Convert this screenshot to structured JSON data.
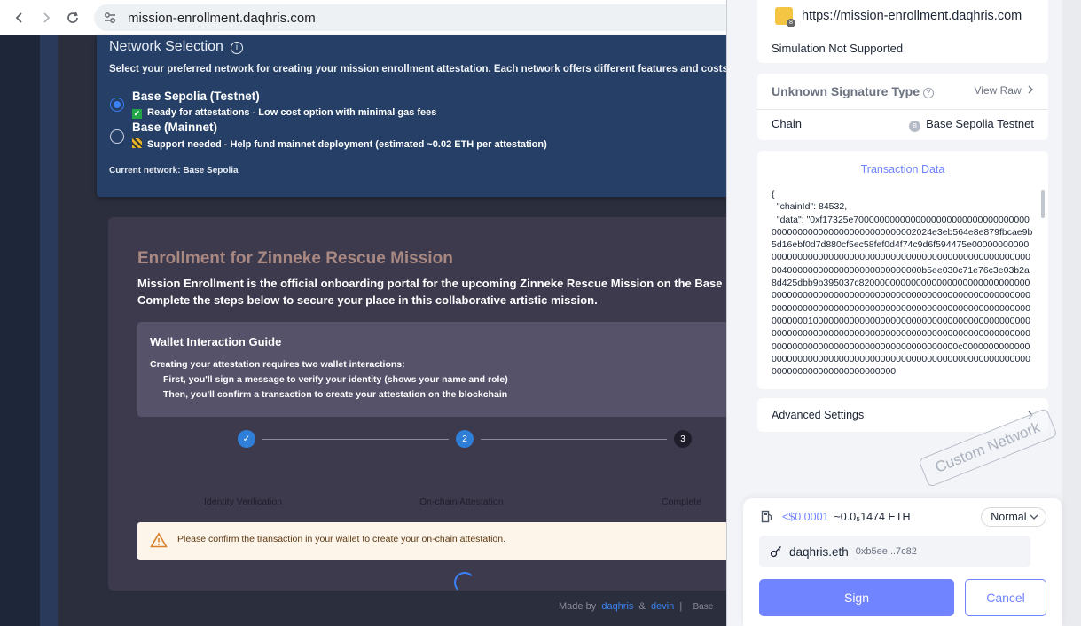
{
  "browser": {
    "url": "mission-enrollment.daqhris.com"
  },
  "network_selection": {
    "title": "Network Selection",
    "info_icon": "info-icon",
    "description": "Select your preferred network for creating your mission enrollment attestation. Each network offers different features and costs.",
    "options": [
      {
        "name": "Base Sepolia (Testnet)",
        "sub": "Ready for attestations - Low cost option with minimal gas fees",
        "badge_color": "#22a447",
        "selected": true
      },
      {
        "name": "Base (Mainnet)",
        "sub": "Support needed - Help fund mainnet deployment (estimated ~0.02 ETH per attestation)",
        "badge_color": "#e5b42a",
        "selected": false
      }
    ],
    "current": "Current network: Base Sepolia"
  },
  "enrollment": {
    "title": "Enrollment for Zinneke Rescue Mission",
    "line1": "Mission Enrollment is the official onboarding portal for the upcoming Zinneke Rescue Mission on the Base blockchain",
    "line2": "Complete the steps below to secure your place in this collaborative artistic mission.",
    "guide": {
      "title": "Wallet Interaction Guide",
      "intro": "Creating your attestation requires two wallet interactions:",
      "step1": "First, you'll sign a message to verify your identity (shows your name and role)",
      "step2": "Then, you'll confirm a transaction to create your attestation on the blockchain"
    },
    "steps": [
      {
        "label": "Identity Verification",
        "marker": "✓"
      },
      {
        "label": "On-chain Attestation",
        "marker": "2"
      },
      {
        "label": "Complete",
        "marker": "3"
      }
    ],
    "alert": "Please confirm the transaction in your wallet to create your on-chain attestation."
  },
  "footer": {
    "made_by": "Made by",
    "author1": "daqhris",
    "amp": "&",
    "author2": "devin",
    "sep": "|",
    "chain": "Base"
  },
  "wallet": {
    "site_url": "https://mission-enrollment.daqhris.com",
    "simulation": "Simulation Not Supported",
    "signature_type": "Unknown Signature Type",
    "view_raw": "View Raw",
    "chain_label": "Chain",
    "chain_value": "Base Sepolia Testnet",
    "tx_title": "Transaction Data",
    "tx_data": "{\n  \"chainId\": 84532,\n  \"data\": \"0xf17325e70000000000000000000000000000000000000000000000000000000000002024e3eb564e8e879fbcae9b5d16ebf0d7d880cf5ec58fef0d4f74c9d6f594475e000000000000000000000000000000000000000000000000000000000000000400000000000000000000000000b5ee030c71e76c3e03b2a8d425dbb9b395037c82000000000000000000000000000000000000000000000000000000000000000000000000000000000000000000000000000000000000000000000000000000000000000000100000000000000000000000000000000000000000000000000000000000000000000000000000000000000000000000000000000000000000000000000000000c000000000000000000000000000000000000000000000000000000000000000000000000000000000000000",
    "advanced": "Advanced Settings",
    "watermark": "Custom Network",
    "gas_usd": "<$0.0001",
    "gas_eth": "~0.0₅1474 ETH",
    "gas_speed": "Normal",
    "account_name": "daqhris.eth",
    "account_addr": "0xb5ee...7c82",
    "sign": "Sign",
    "cancel": "Cancel"
  }
}
